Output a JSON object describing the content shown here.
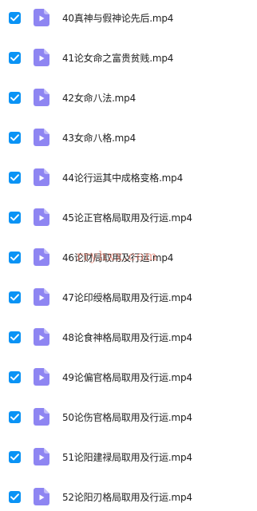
{
  "colors": {
    "checkbox_fill": "#0a93f5",
    "file_icon": "#8e85f2",
    "text": "#222222",
    "watermark": "#de5a46"
  },
  "icons": {
    "checkbox": "checkmark-icon",
    "file": "video-file-icon"
  },
  "files": [
    {
      "name": "40真神与假神论先后.mp4",
      "checked": true
    },
    {
      "name": "41论女命之富贵贫贱.mp4",
      "checked": true
    },
    {
      "name": "42女命八法.mp4",
      "checked": true
    },
    {
      "name": "43女命八格.mp4",
      "checked": true
    },
    {
      "name": "44论行运其中成格变格.mp4",
      "checked": true
    },
    {
      "name": "45论正官格局取用及行运.mp4",
      "checked": true
    },
    {
      "name": "46论财局取用及行运.mp4",
      "checked": true
    },
    {
      "name": "47论印绶格局取用及行运.mp4",
      "checked": true
    },
    {
      "name": "48论食神格局取用及行运.mp4",
      "checked": true
    },
    {
      "name": "49论偏官格局取用及行运.mp4",
      "checked": true
    },
    {
      "name": "50论伤官格局取用及行运.mp4",
      "checked": true
    },
    {
      "name": "51论阳建禄局取用及行运.mp4",
      "checked": true
    },
    {
      "name": "52论阳刃格局取用及行运.mp4",
      "checked": true
    }
  ],
  "watermark": "rryhxx.com"
}
